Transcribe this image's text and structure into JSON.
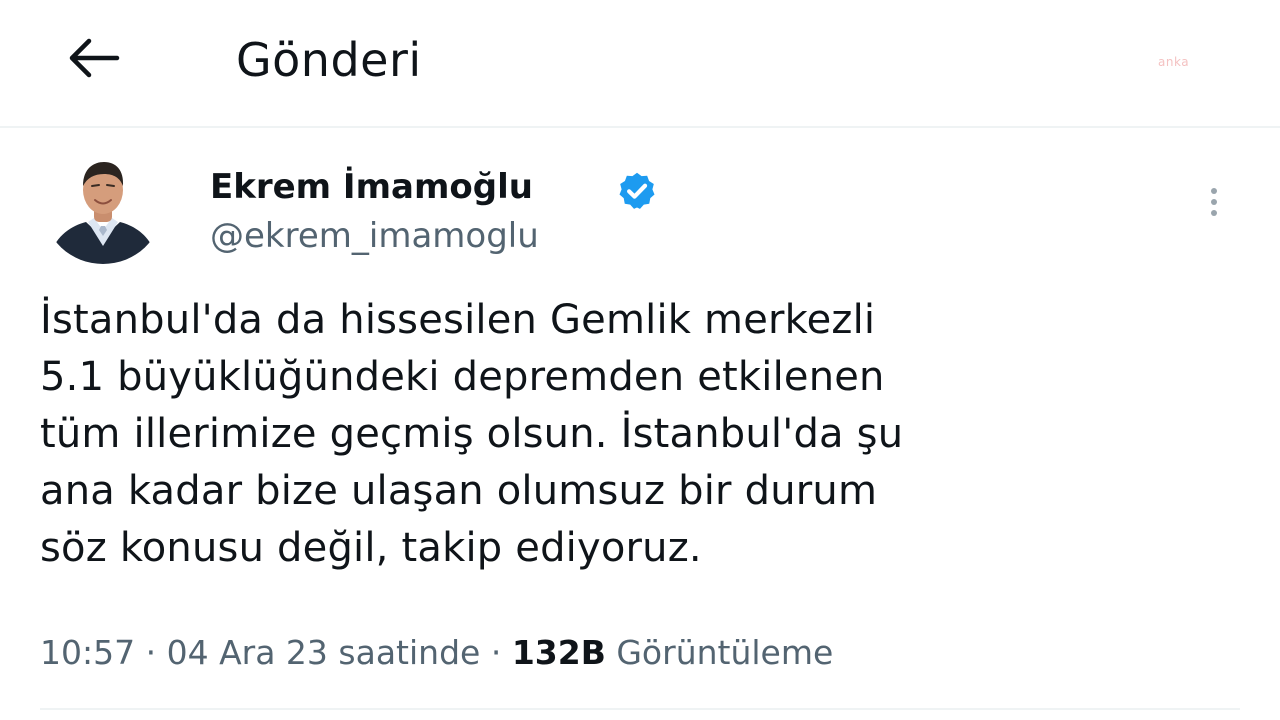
{
  "header": {
    "back_icon": "arrow-left-icon",
    "title": "Gönderi",
    "watermark": "anka"
  },
  "author": {
    "name": "Ekrem İmamoğlu",
    "handle": "@ekrem_imamoglu",
    "verified_icon": "verified-badge-icon",
    "verified_color": "#1d9bf0",
    "more_icon": "more-vertical-icon"
  },
  "tweet": {
    "lines": [
      "İstanbul'da da hissesilen Gemlik merkezli",
      "5.1 büyüklüğündeki depremden etkilenen",
      "tüm illerimize geçmiş olsun. İstanbul'da şu",
      "ana kadar bize ulaşan olumsuz bir durum",
      "söz konusu değil, takip ediyoruz."
    ]
  },
  "meta": {
    "time": "10:57",
    "separator": " · ",
    "date": "04 Ara 23 saatinde",
    "views_count": "132B",
    "views_label": "Görüntüleme"
  },
  "colors": {
    "text_primary": "#0f1419",
    "text_secondary": "#536471",
    "divider": "#eff3f4"
  }
}
